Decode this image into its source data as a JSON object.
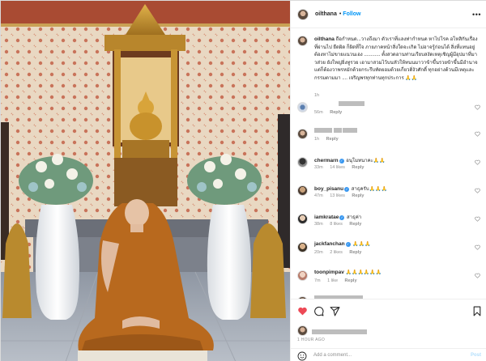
{
  "post": {
    "username": "oilthana",
    "follow_label": "Follow",
    "dot": "•",
    "more_icon": "more-horizontal-icon",
    "caption_text": "ถือกำหนด...วางถึงมา ตัวเราที่แลงท่ากำหนด หาไปโรค อโหสิกันเรื่องที่ผ่านไป ยืดผิด ก็ผิดที่ใจ ภายภาคหน้าสิ่งใดจะเกิด ไม่อาจรู้ก่อนได้ สิ่งที่แทนอยู่ต้องหาไม่ขายแนวนเอง ............ ตั้งสวดอานท่านเรียบสงัดเหตุเชิญผู้มีอุปมาที่มาวส่วย ยังใหญ่ยิ่งทูรวย เอามาสวมไว้บนหัวให้ทนนมาวาข้าขึ้นรวยข้าขึ้นมีอำนาจแต่ก็ต้องวาพรหมักด้วยกระรึบทัดยอมด้วยเกี่ยวติ่งัวศักดิ์ ทุกอย่างด้วนมีเหตุและกรรมตามมา .... เจริญพรทุกท่านทุกประการ 🙏🙏",
    "caption_time": "1h"
  },
  "comments": [
    {
      "user": "",
      "text": "",
      "meta": [
        "56m",
        "Reply"
      ]
    },
    {
      "user": "",
      "text": "",
      "meta": [
        "1h",
        "Reply"
      ]
    },
    {
      "user": "chermarn",
      "text": "อนุโมทนาคะ🙏🙏",
      "meta": [
        "33m",
        "14 likes",
        "Reply"
      ]
    },
    {
      "user": "boy_pisanu",
      "text": "สาธุครับ🙏🙏🙏",
      "meta": [
        "47m",
        "13 likes",
        "Reply"
      ]
    },
    {
      "user": "iamkratae",
      "text": "สาธุค่า",
      "meta": [
        "38m",
        "8 likes",
        "Reply"
      ]
    },
    {
      "user": "jackfanchan",
      "text": "🙏🙏🙏",
      "meta": [
        "20m",
        "2 likes",
        "Reply"
      ]
    },
    {
      "user": "toonpimpav",
      "text": "🙏🙏🙏🙏🙏🙏",
      "meta": [
        "7m",
        "1 like",
        "Reply"
      ]
    },
    {
      "user": "",
      "text": "",
      "meta": []
    }
  ],
  "actions": {
    "like_icon": "heart-filled-icon",
    "comment_icon": "comment-icon",
    "share_icon": "share-icon",
    "save_icon": "bookmark-icon",
    "time_ago": "1 HOUR AGO",
    "add_comment_placeholder": "Add a comment...",
    "post_label": "Post"
  },
  "colors": {
    "link": "#0095f6",
    "verified": "#3897f0",
    "like": "#ed4956",
    "robe": "#b8691e"
  }
}
